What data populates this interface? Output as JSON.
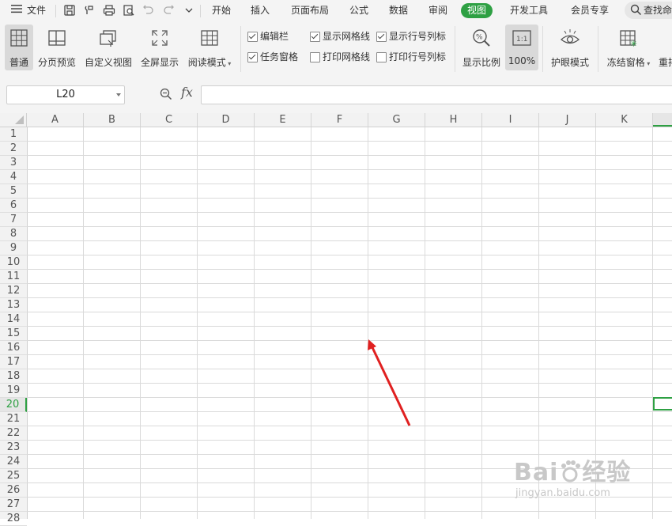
{
  "menubar": {
    "menu_label": "文件",
    "tabs": [
      {
        "label": "开始"
      },
      {
        "label": "插入"
      },
      {
        "label": "页面布局"
      },
      {
        "label": "公式"
      },
      {
        "label": "数据"
      },
      {
        "label": "审阅"
      },
      {
        "label": "视图",
        "active": true
      },
      {
        "label": "开发工具"
      },
      {
        "label": "会员专享"
      }
    ],
    "search_label": "查找命"
  },
  "ribbon": {
    "buttons": {
      "normal": "普通",
      "page_break": "分页预览",
      "custom_view": "自定义视图",
      "full_screen": "全屏显示",
      "reading_mode": "阅读模式",
      "zoom": "显示比例",
      "zoom_100": "100%",
      "eye_protect": "护眼模式",
      "freeze": "冻结窗格",
      "rearrange": "重排"
    },
    "checks": {
      "edit_bar": {
        "label": "编辑栏",
        "checked": true
      },
      "task_pane": {
        "label": "任务窗格",
        "checked": true
      },
      "show_grid": {
        "label": "显示网格线",
        "checked": true
      },
      "print_grid": {
        "label": "打印网格线",
        "checked": false
      },
      "show_headers": {
        "label": "显示行号列标",
        "checked": true
      },
      "print_headers": {
        "label": "打印行号列标",
        "checked": false
      }
    }
  },
  "formula_bar": {
    "name_box": "L20",
    "fx": "fx",
    "value": ""
  },
  "sheet": {
    "columns": [
      "A",
      "B",
      "C",
      "D",
      "E",
      "F",
      "G",
      "H",
      "I",
      "J",
      "K"
    ],
    "rows": [
      "1",
      "2",
      "3",
      "4",
      "5",
      "6",
      "7",
      "8",
      "9",
      "10",
      "11",
      "12",
      "13",
      "14",
      "15",
      "16",
      "17",
      "18",
      "19",
      "20",
      "21",
      "22",
      "23",
      "24",
      "25",
      "26",
      "27",
      "28"
    ],
    "selected_row": "20",
    "selected_cell": "L20"
  },
  "watermark": {
    "brand": "Bai du 经验",
    "url": "jingyan.baidu.com"
  },
  "colors": {
    "accent": "#2ea043",
    "arrow": "#e02020"
  }
}
